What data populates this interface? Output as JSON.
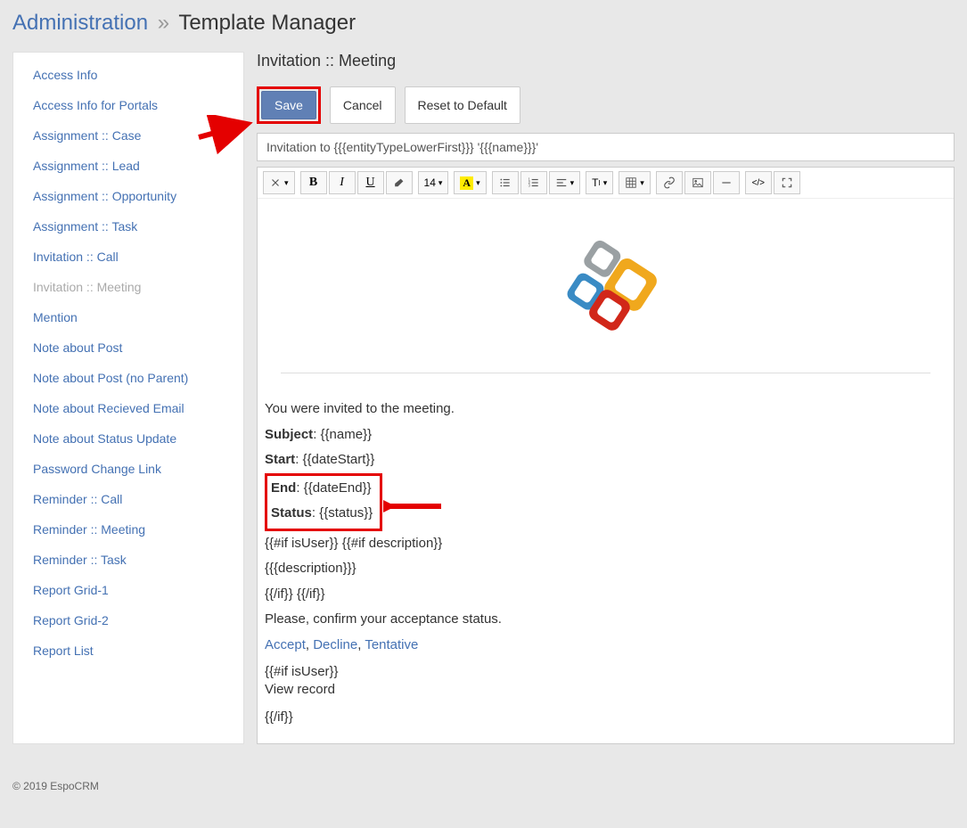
{
  "breadcrumb": {
    "root": "Administration",
    "sep": "»",
    "current": "Template Manager"
  },
  "sidebar": {
    "items": [
      {
        "label": "Access Info",
        "active": false
      },
      {
        "label": "Access Info for Portals",
        "active": false
      },
      {
        "label": "Assignment :: Case",
        "active": false
      },
      {
        "label": "Assignment :: Lead",
        "active": false
      },
      {
        "label": "Assignment :: Opportunity",
        "active": false
      },
      {
        "label": "Assignment :: Task",
        "active": false
      },
      {
        "label": "Invitation :: Call",
        "active": false
      },
      {
        "label": "Invitation :: Meeting",
        "active": true
      },
      {
        "label": "Mention",
        "active": false
      },
      {
        "label": "Note about Post",
        "active": false
      },
      {
        "label": "Note about Post (no Parent)",
        "active": false
      },
      {
        "label": "Note about Recieved Email",
        "active": false
      },
      {
        "label": "Note about Status Update",
        "active": false
      },
      {
        "label": "Password Change Link",
        "active": false
      },
      {
        "label": "Reminder :: Call",
        "active": false
      },
      {
        "label": "Reminder :: Meeting",
        "active": false
      },
      {
        "label": "Reminder :: Task",
        "active": false
      },
      {
        "label": "Report Grid-1",
        "active": false
      },
      {
        "label": "Report Grid-2",
        "active": false
      },
      {
        "label": "Report List",
        "active": false
      }
    ]
  },
  "main": {
    "title": "Invitation :: Meeting",
    "save": "Save",
    "cancel": "Cancel",
    "reset": "Reset to Default",
    "subject_value": "Invitation to {{{entityTypeLowerFirst}}} '{{{name}}}'"
  },
  "toolbar": {
    "fontSize": "14"
  },
  "body": {
    "line1": "You were invited to the meeting.",
    "subject_label": "Subject",
    "subject_val": ": {{name}}",
    "start_label": "Start",
    "start_val": ": {{dateStart}}",
    "end_label": "End",
    "end_val": ": {{dateEnd}}",
    "status_label": "Status",
    "status_val": ": {{status}}",
    "line_ifuser": "{{#if isUser}} {{#if description}}",
    "line_desc": "{{{description}}}",
    "line_endif": "{{/if}} {{/if}}",
    "line_confirm": "Please, confirm your acceptance status.",
    "accept": "Accept",
    "sep": ", ",
    "decline": "Decline",
    "tentative": "Tentative",
    "line_ifuser2": "{{#if isUser}}",
    "line_view": "View record",
    "line_endif2": "{{/if}}"
  },
  "footer": "© 2019 EspoCRM"
}
